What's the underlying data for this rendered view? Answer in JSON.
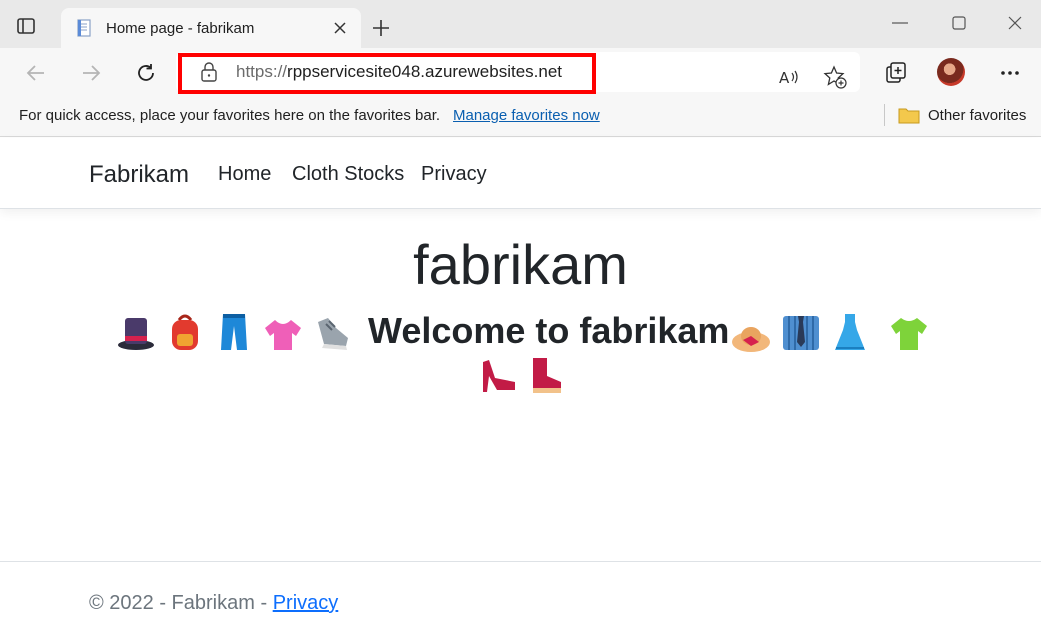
{
  "browser": {
    "tab_title": "Home page - fabrikam",
    "url_scheme": "https://",
    "url_host": "rppservicesite048.azurewebsites.net",
    "favorites_prompt": "For quick access, place your favorites here on the favorites bar.",
    "manage_favorites": "Manage favorites now",
    "other_favorites": "Other favorites",
    "highlight_color": "#ff0000"
  },
  "site": {
    "brand": "Fabrikam",
    "nav": [
      "Home",
      "Cloth Stocks",
      "Privacy"
    ],
    "hero_title": "fabrikam",
    "welcome": "Welcome to fabrikam",
    "emoji_icons": [
      "top-hat",
      "backpack",
      "jeans",
      "blouse",
      "running-shoe",
      "womans-hat",
      "shirt-tie",
      "dress",
      "t-shirt",
      "high-heel",
      "boot"
    ]
  },
  "footer": {
    "copyright": "© 2022 - Fabrikam - ",
    "privacy": "Privacy"
  }
}
